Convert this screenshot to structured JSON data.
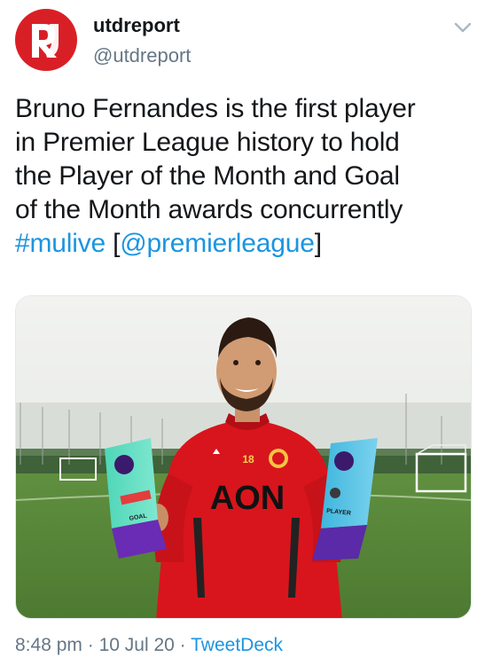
{
  "user": {
    "name": "utdreport",
    "handle": "@utdreport",
    "avatar_icon": "utdreport-logo-icon",
    "accent": "#d91f26"
  },
  "menu_icon": "chevron-down-icon",
  "tweet": {
    "lines": [
      "Bruno Fernandes is the first player",
      "in Premier League history to hold",
      "the Player of the Month and Goal",
      "of the Month awards concurrently"
    ],
    "hashtag": "#mulive",
    "bracket_open": "[",
    "mention": "@premierleague",
    "bracket_close": "]",
    "link_color": "#1b95e0"
  },
  "media": {
    "jersey_number": "18",
    "sponsor": "AON",
    "left_trophy_label": "GOAL",
    "right_trophy_label": "PLAYER"
  },
  "meta": {
    "time": "8:48 pm",
    "separator": "·",
    "date": "10 Jul 20",
    "source": "TweetDeck"
  }
}
